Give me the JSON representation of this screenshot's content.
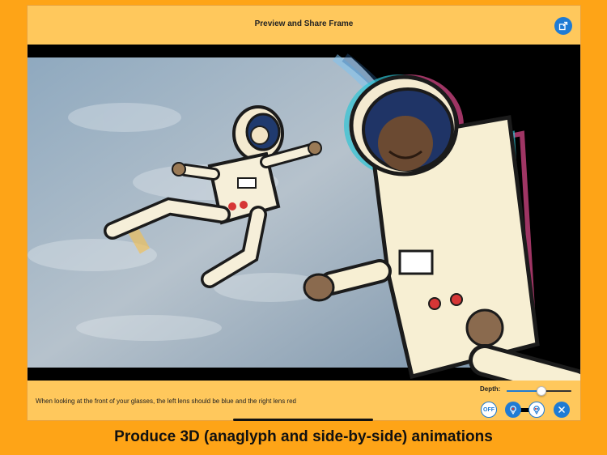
{
  "header": {
    "title": "Preview and Share Frame",
    "share_icon": "share-external-icon"
  },
  "preview": {
    "image_desc_icon": "anaglyph-astronauts-scene"
  },
  "footer": {
    "hint": "When looking at the front of your glasses, the left lens should be blue and the right lens red",
    "depth_label": "Depth:",
    "depth_value": 0.55,
    "off_label": "OFF",
    "accent": "#1F7BD4"
  },
  "caption": "Produce 3D (anaglyph and side-by-side) animations",
  "colors": {
    "background": "#FEA417",
    "panel": "#FFC85C"
  }
}
